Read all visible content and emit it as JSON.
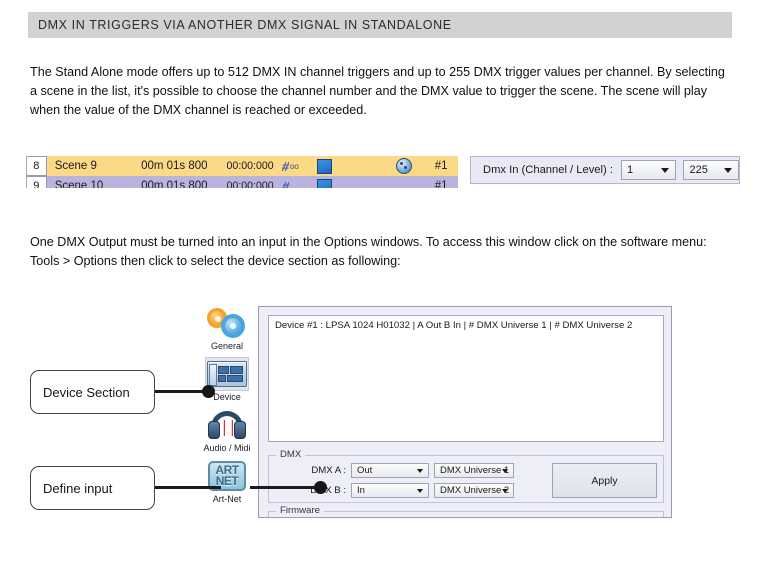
{
  "header": {
    "title": "DMX IN TRIGGERS VIA ANOTHER DMX SIGNAL IN STANDALONE",
    "background": "#d2d2d2"
  },
  "paragraphs": {
    "first": "The Stand Alone mode offers up to 512 DMX IN channel triggers and up to 255 DMX trigger values per channel.  By selecting a scene in the list, it's possible to choose the channel number and the DMX value to trigger the scene. The scene will play when the value of the DMX channel is reached or exceeded.",
    "second": "One DMX Output must be turned into an input in the Options windows. To access this window click on the software menu: Tools > Options  then click to select the device section as following:"
  },
  "scene_list": {
    "selected_row": {
      "number": "8",
      "name": "Scene 9",
      "duration": "00m 01s 800",
      "timecode": "00:00:000",
      "hash_icon": "hash-icon",
      "hash_suffix": "oo",
      "square_icon": "blue-square-icon",
      "globe_icon": "globe-icon",
      "reference": "#1",
      "row_color": "#fcd986"
    },
    "next_row": {
      "number": "9",
      "name": "Scene 10",
      "duration": "00m 01s 800",
      "timecode": "00:00:000",
      "reference": "#1",
      "row_color": "#b9b3dd"
    }
  },
  "dmx_in_panel": {
    "label": "Dmx In (Channel / Level) :",
    "channel_value": "1",
    "level_value": "225"
  },
  "options_dialog": {
    "device_list": {
      "items": [
        "Device #1 : LPSA 1024 H01032 | A Out B In | # DMX Universe 1 | # DMX Universe 2"
      ]
    },
    "sidebar": {
      "items": [
        {
          "label": "General",
          "icon": "gears-icon",
          "active": false
        },
        {
          "label": "Device",
          "icon": "device-card-icon",
          "active": true
        },
        {
          "label": "Audio / Midi",
          "icon": "headphones-icon",
          "active": false
        },
        {
          "label": "Art-Net",
          "icon": "artnet-icon",
          "active": false
        }
      ]
    },
    "dmx_group": {
      "title": "DMX",
      "rows": [
        {
          "label": "DMX A :",
          "mode": "Out",
          "universe": "DMX Universe 1"
        },
        {
          "label": "DMX B :",
          "mode": "In",
          "universe": "DMX Universe 2"
        }
      ],
      "apply_label": "Apply"
    },
    "firmware_group": {
      "title": "Firmware"
    }
  },
  "callouts": [
    {
      "label": "Device Section"
    },
    {
      "label": "Define input"
    }
  ],
  "artnet_icon": {
    "line1": "ART",
    "line2": "NET"
  }
}
